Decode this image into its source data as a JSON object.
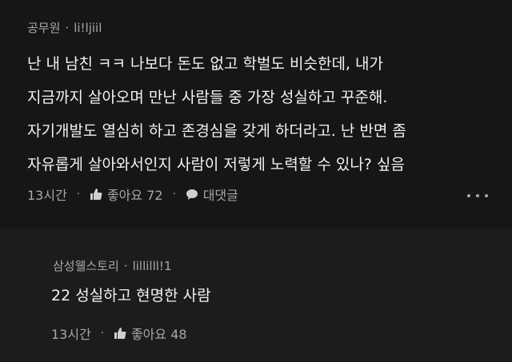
{
  "comment1": {
    "author": "공무원",
    "separator": "·",
    "handle": "li!ljiil",
    "lines": [
      "난 내 남친 ㅋㅋ 나보다 돈도 없고 학벌도 비슷한데, 내가",
      "지금까지 살아오며 만난 사람들 중 가장 성실하고 꾸준해.",
      "자기개발도 열심히 하고 존경심을 갖게 하더라고. 난 반면 좀",
      "자유롭게 살아와서인지 사람이 저렇게 노력할 수 있나? 싶음"
    ],
    "time": "13시간",
    "like_label": "좋아요 72",
    "reply_label": "대댓글"
  },
  "comment2": {
    "author": "삼성웰스토리",
    "separator": "·",
    "handle": "lillilll!1",
    "text": "22 성실하고 현명한 사람",
    "time": "13시간",
    "like_label": "좋아요 48"
  },
  "colors": {
    "background": "#161616",
    "reply_background": "#1c1c1c",
    "text": "#f2f2f2",
    "meta": "#a8a8a8"
  },
  "icons": {
    "like": "thumbs-up-icon",
    "reply": "speech-bubble-icon",
    "more": "more-dots-icon"
  }
}
